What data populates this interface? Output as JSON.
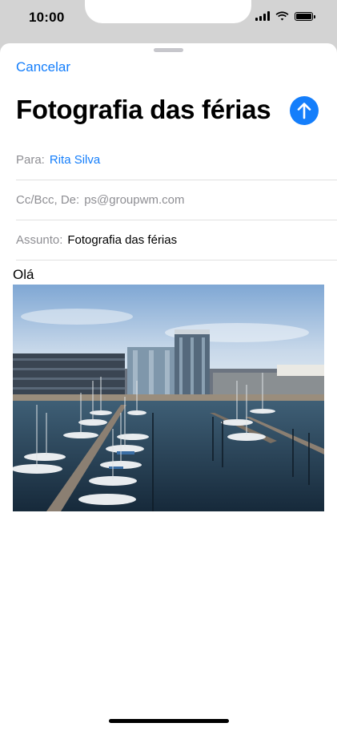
{
  "status_bar": {
    "time": "10:00",
    "icons": [
      "signal-icon",
      "wifi-icon",
      "battery-icon"
    ]
  },
  "compose": {
    "cancel_label": "Cancelar",
    "title": "Fotografia das férias",
    "send_icon": "arrow-up-icon",
    "to_label": "Para:",
    "to_value": "Rita Silva",
    "cc_label": "Cc/Bcc, De:",
    "cc_value": "ps@groupwm.com",
    "subject_label": "Assunto:",
    "subject_value": "Fotografia das férias",
    "body_text": "Olá",
    "attachment_icon": "photo-harbour-image"
  },
  "colors": {
    "accent": "#147efb",
    "secondary_text": "#8e8e93",
    "background_dim": "#d3d3d3"
  }
}
